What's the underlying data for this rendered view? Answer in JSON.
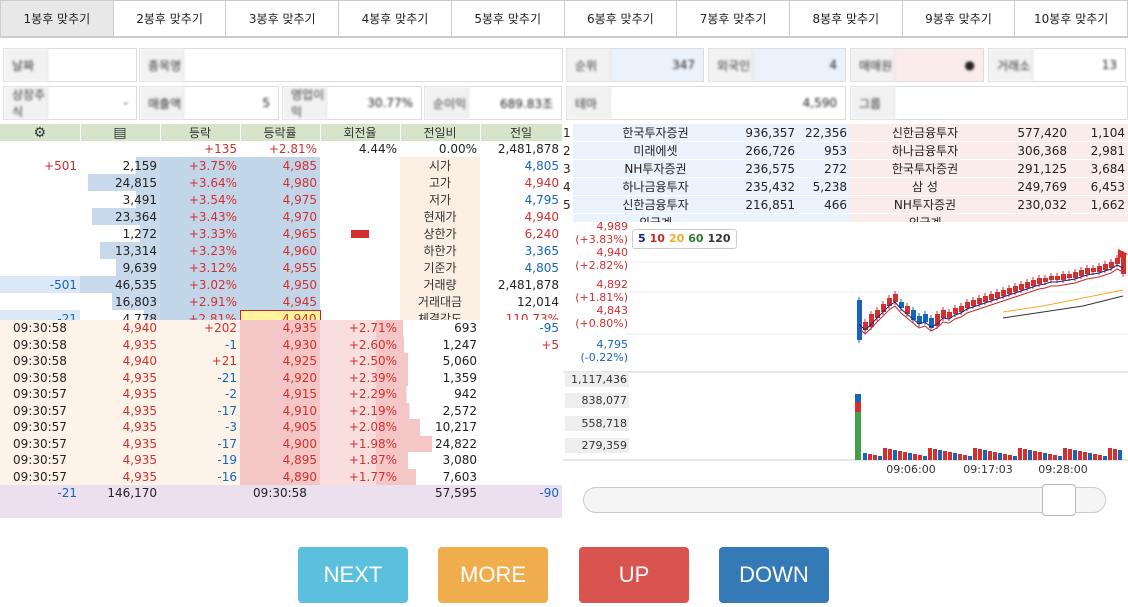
{
  "tabs": [
    "1봉후 맞추기",
    "2봉후 맞추기",
    "3봉후 맞추기",
    "4봉후 맞추기",
    "5봉후 맞추기",
    "6봉후 맞추기",
    "7봉후 맞추기",
    "8봉후 맞추기",
    "9봉후 맞추기",
    "10봉후 맞추기"
  ],
  "info_row1": [
    {
      "label": "날짜",
      "value": ""
    },
    {
      "label": "종목명",
      "value": ""
    },
    {
      "label": "순위",
      "value": "347"
    },
    {
      "label": "외국인",
      "value": "4"
    },
    {
      "label": "매매원",
      "value": "●"
    },
    {
      "label": "거래소",
      "value": "13"
    }
  ],
  "info_row2": [
    {
      "label": "상장주식",
      "value": "-"
    },
    {
      "label": "매출액",
      "value": "5"
    },
    {
      "label": "영업이익",
      "value": "30.77%"
    },
    {
      "label": "순이익",
      "value": "689.83조"
    },
    {
      "label": "테마",
      "value": "4,590"
    },
    {
      "label": "그룹",
      "value": ""
    }
  ],
  "orderbook": {
    "headers": [
      "등락",
      "등락률",
      "회전율",
      "전일비",
      "전일"
    ],
    "summary": {
      "change": "+135",
      "rate": "+2.81%",
      "turnover": "4.44%",
      "prevratio": "0.00%",
      "prev": "2,481,878"
    },
    "asks": [
      {
        "chg": "+501",
        "qty": "2,159",
        "rate": "+3.75%",
        "price": "4,985"
      },
      {
        "chg": "",
        "qty": "24,815",
        "rate": "+3.64%",
        "price": "4,980"
      },
      {
        "chg": "",
        "qty": "3,491",
        "rate": "+3.54%",
        "price": "4,975"
      },
      {
        "chg": "",
        "qty": "23,364",
        "rate": "+3.43%",
        "price": "4,970"
      },
      {
        "chg": "",
        "qty": "1,272",
        "rate": "+3.33%",
        "price": "4,965"
      },
      {
        "chg": "",
        "qty": "13,314",
        "rate": "+3.23%",
        "price": "4,960"
      },
      {
        "chg": "",
        "qty": "9,639",
        "rate": "+3.12%",
        "price": "4,955"
      },
      {
        "chg": "-501",
        "qty": "46,535",
        "rate": "+3.02%",
        "price": "4,950"
      },
      {
        "chg": "",
        "qty": "16,803",
        "rate": "+2.91%",
        "price": "4,945"
      },
      {
        "chg": "-21",
        "qty": "4,778",
        "rate": "+2.81%",
        "price": "4,940"
      }
    ],
    "stats": [
      {
        "label": "시가",
        "value": "4,805"
      },
      {
        "label": "고가",
        "value": "4,940"
      },
      {
        "label": "저가",
        "value": "4,795"
      },
      {
        "label": "현재가",
        "value": "4,940"
      },
      {
        "label": "상한가",
        "value": "6,240"
      },
      {
        "label": "하한가",
        "value": "3,365"
      },
      {
        "label": "기준가",
        "value": "4,805"
      },
      {
        "label": "거래량",
        "value": "2,481,878"
      },
      {
        "label": "거래대금",
        "value": "12,014"
      },
      {
        "label": "체결강도",
        "value": "110.73%"
      }
    ]
  },
  "trades": [
    {
      "time": "09:30:58",
      "price": "4,940",
      "chg": "+202",
      "p2": "4,935",
      "rate": "+2.71%",
      "vol": "693",
      "diff": "-95"
    },
    {
      "time": "09:30:58",
      "price": "4,935",
      "chg": "-1",
      "p2": "4,930",
      "rate": "+2.60%",
      "vol": "1,247",
      "diff": "+5"
    },
    {
      "time": "09:30:58",
      "price": "4,940",
      "chg": "+21",
      "p2": "4,925",
      "rate": "+2.50%",
      "vol": "5,060",
      "diff": ""
    },
    {
      "time": "09:30:58",
      "price": "4,935",
      "chg": "-21",
      "p2": "4,920",
      "rate": "+2.39%",
      "vol": "1,359",
      "diff": ""
    },
    {
      "time": "09:30:57",
      "price": "4,935",
      "chg": "-2",
      "p2": "4,915",
      "rate": "+2.29%",
      "vol": "942",
      "diff": ""
    },
    {
      "time": "09:30:57",
      "price": "4,935",
      "chg": "-17",
      "p2": "4,910",
      "rate": "+2.19%",
      "vol": "2,572",
      "diff": ""
    },
    {
      "time": "09:30:57",
      "price": "4,935",
      "chg": "-3",
      "p2": "4,905",
      "rate": "+2.08%",
      "vol": "10,217",
      "diff": ""
    },
    {
      "time": "09:30:57",
      "price": "4,935",
      "chg": "-17",
      "p2": "4,900",
      "rate": "+1.98%",
      "vol": "24,822",
      "diff": ""
    },
    {
      "time": "09:30:57",
      "price": "4,935",
      "chg": "-19",
      "p2": "4,895",
      "rate": "+1.87%",
      "vol": "3,080",
      "diff": ""
    },
    {
      "time": "09:30:57",
      "price": "4,935",
      "chg": "-16",
      "p2": "4,890",
      "rate": "+1.77%",
      "vol": "7,603",
      "diff": ""
    }
  ],
  "trade_summary": {
    "chg": "-21",
    "qty": "146,170",
    "time": "09:30:58",
    "vol": "57,595",
    "diff": "-90"
  },
  "brokers": [
    {
      "no": "1",
      "sell": "한국투자증권",
      "sq": "936,357",
      "sd": "22,356",
      "buy": "신한금융투자",
      "bq": "577,420",
      "bd": "1,104"
    },
    {
      "no": "2",
      "sell": "미래에셋",
      "sq": "266,726",
      "sd": "953",
      "buy": "하나금융투자",
      "bq": "306,368",
      "bd": "2,981"
    },
    {
      "no": "3",
      "sell": "NH투자증권",
      "sq": "236,575",
      "sd": "272",
      "buy": "한국투자증권",
      "bq": "291,125",
      "bd": "3,684"
    },
    {
      "no": "4",
      "sell": "하나금융투자",
      "sq": "235,432",
      "sd": "5,238",
      "buy": "삼 성",
      "bq": "249,769",
      "bd": "6,453"
    },
    {
      "no": "5",
      "sell": "신한금융투자",
      "sq": "216,851",
      "sd": "466",
      "buy": "NH투자증권",
      "bq": "230,032",
      "bd": "1,662"
    }
  ],
  "foreign_label": "외국계",
  "ma_legend": [
    "5",
    "10",
    "20",
    "60",
    "120"
  ],
  "colors": {
    "up": "#d32f2f",
    "down": "#1565c0",
    "ma5": "#1a237e",
    "ma10": "#c62828",
    "ma20": "#f9a825",
    "ma60": "#2e7d32",
    "ma120": "#333333"
  },
  "chart_data": {
    "type": "candlestick",
    "price_axis": [
      {
        "price": "4,989",
        "pct": "(+3.83%)"
      },
      {
        "price": "4,940",
        "pct": "(+2.82%)"
      },
      {
        "price": "4,892",
        "pct": "(+1.81%)"
      },
      {
        "price": "4,843",
        "pct": "(+0.80%)"
      },
      {
        "price": "4,795",
        "pct": "(-0.22%)"
      }
    ],
    "volume_axis": [
      "1,117,436",
      "838,077",
      "558,718",
      "279,359"
    ],
    "time_axis": [
      "09:06:00",
      "09:17:03",
      "09:28:00"
    ]
  },
  "buttons": {
    "next": "NEXT",
    "more": "MORE",
    "up": "UP",
    "down": "DOWN"
  }
}
